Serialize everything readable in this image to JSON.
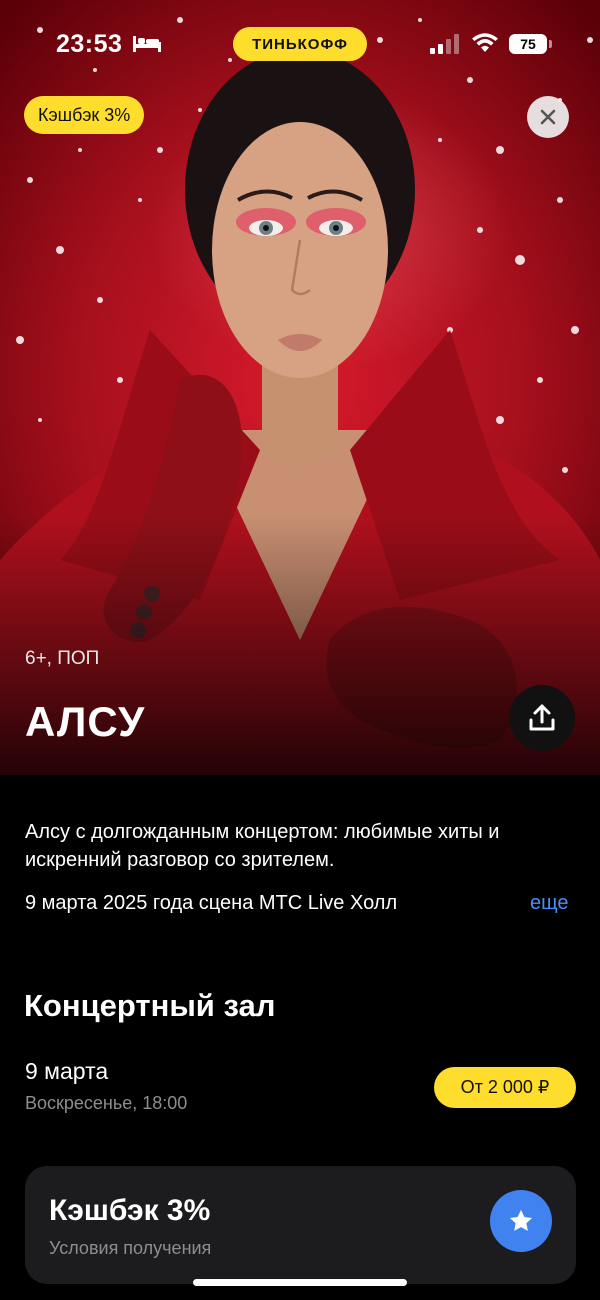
{
  "status_bar": {
    "time": "23:53",
    "brand": "ТИНЬКОФФ",
    "battery": "75"
  },
  "hero": {
    "cashback_badge": "Кэшбэк 3%",
    "genre": "6+, ПОП",
    "title": "АЛСУ"
  },
  "event": {
    "description": "Алсу с долгожданным концертом: любимые хиты и искренний разговор со зрителем.",
    "date_line": "9 марта 2025 года сцена МТС Live Холл",
    "more_label": "еще"
  },
  "venue": {
    "title": "Концертный зал",
    "session": {
      "date": "9 марта",
      "time": "Воскресенье, 18:00",
      "price": "От 2 000 ₽"
    }
  },
  "cashback_card": {
    "title": "Кэшбэк 3%",
    "subtitle": "Условия получения"
  },
  "icons": [
    "sleep-icon",
    "signal-icon",
    "wifi-icon",
    "battery-icon",
    "close-icon",
    "share-icon",
    "star-icon"
  ],
  "colors": {
    "accent_yellow": "#ffdd2d",
    "link_blue": "#4b8df8",
    "star_blue": "#3f82f0",
    "card_bg": "#1c1c1e",
    "hero_red": "#c8152a"
  }
}
